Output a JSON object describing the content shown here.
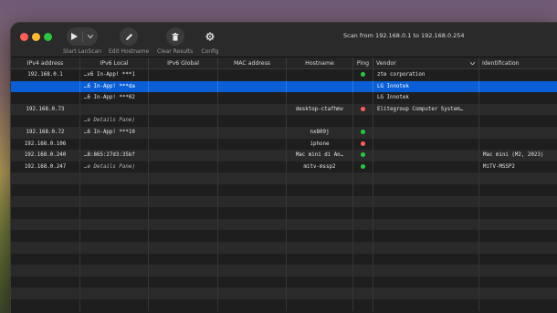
{
  "toolbar": {
    "start_label": "Start LanScan",
    "edit_label": "Edit Hostname",
    "clear_label": "Clear Results",
    "config_label": "Config",
    "scan_info": "Scan from 192.168.0.1 to 192.168.0.254"
  },
  "columns": {
    "ipv4": "IPv4 address",
    "ipv6local": "IPv6 Local",
    "ipv6global": "IPv6 Global",
    "mac": "MAC address",
    "hostname": "Hostname",
    "ping": "Ping",
    "vendor": "Vendor",
    "identification": "Identification"
  },
  "status_colors": {
    "green": "#27c93f",
    "red": "#ff5f57"
  },
  "rows": [
    {
      "ipv4": "192.168.0.1",
      "ipv6local": "…v6 In-App! ***1",
      "ipv6global": "",
      "mac": "",
      "hostname": "",
      "ping": "green",
      "vendor": "zte corporation",
      "identification": ""
    },
    {
      "ipv4": "",
      "ipv6local": "…6 In-App! ***da",
      "ipv6global": "",
      "mac": "",
      "hostname": "",
      "ping": "",
      "vendor": "LG Innotek",
      "identification": ""
    },
    {
      "ipv4": "",
      "ipv6local": "…6 In-App! ***02",
      "ipv6global": "",
      "mac": "",
      "hostname": "",
      "ping": "",
      "vendor": "LG Innotek",
      "identification": ""
    },
    {
      "ipv4": "192.168.0.73",
      "ipv6local": "",
      "ipv6global": "",
      "mac": "",
      "hostname": "desktop-ctafhmv",
      "ping": "red",
      "vendor": "Elitegroup Computer System…",
      "identification": ""
    },
    {
      "ipv4": "",
      "ipv6local": "…e Details Pane)",
      "ipv6global": "",
      "mac": "",
      "hostname": "",
      "ping": "",
      "vendor": "",
      "identification": ""
    },
    {
      "ipv4": "192.168.0.72",
      "ipv6local": "…6 In-App! ***10",
      "ipv6global": "",
      "mac": "",
      "hostname": "nx809j",
      "ping": "green",
      "vendor": "",
      "identification": ""
    },
    {
      "ipv4": "192.168.0.106",
      "ipv6local": "",
      "ipv6global": "",
      "mac": "",
      "hostname": "iphone",
      "ping": "red",
      "vendor": "",
      "identification": ""
    },
    {
      "ipv4": "192.168.0.240",
      "ipv6local": "…8:865:27d3:35bf",
      "ipv6global": "",
      "mac": "",
      "hostname": "Mac mini di An…",
      "ping": "green",
      "vendor": "",
      "identification": "Mac mini (M2, 2023)"
    },
    {
      "ipv4": "192.168.0.247",
      "ipv6local": "…e Details Pane)",
      "ipv6global": "",
      "mac": "",
      "hostname": "mitv-mssp2",
      "ping": "green",
      "vendor": "",
      "identification": "MiTV-MSSP2"
    }
  ]
}
